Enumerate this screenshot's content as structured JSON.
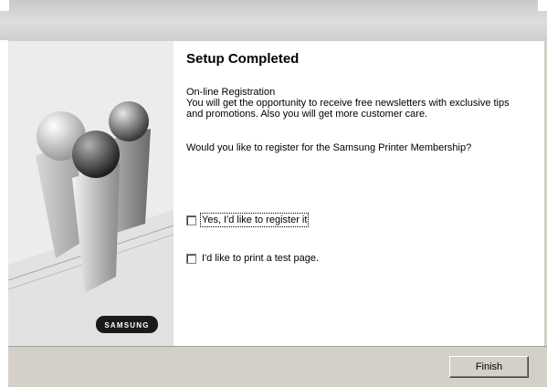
{
  "header": {
    "title": "Setup Completed"
  },
  "registration": {
    "heading": "On-line Registration",
    "line1": "You will get the opportunity to receive free newsletters with exclusive tips",
    "line2": "and promotions. Also you will get more customer care.",
    "question": "Would you like to register for the Samsung Printer Membership?"
  },
  "options": {
    "register_label": "Yes, I'd like to register it",
    "register_checked": false,
    "testpage_label": "I'd like to print a test page.",
    "testpage_checked": false
  },
  "footer": {
    "finish_label": "Finish"
  },
  "sidebar": {
    "logo_text": "SAMSUNG"
  },
  "colors": {
    "window_bg": "#d4d0c8",
    "content_bg": "#ffffff",
    "logo_bg": "#1a1a1a"
  }
}
